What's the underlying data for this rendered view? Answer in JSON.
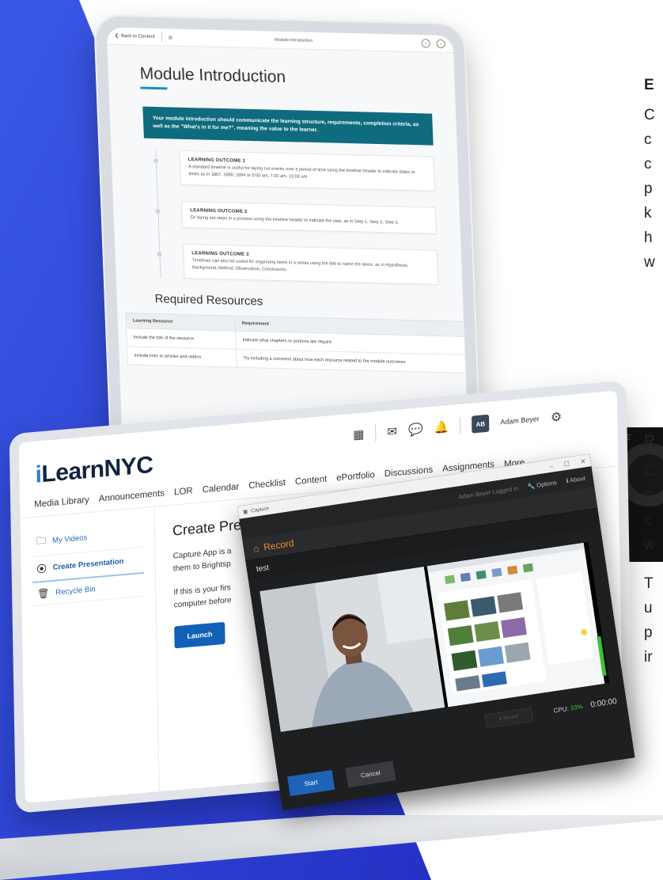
{
  "colors": {
    "blue": "#2d3fd6",
    "brand_blue": "#2a7de1",
    "brand_navy": "#10233f",
    "teal_banner": "#0f6b7e",
    "record_orange": "#f08a2a"
  },
  "tablet": {
    "back_label": "Back to Content",
    "breadcrumb": "Module Introduction",
    "title": "Module Introduction",
    "banner": "Your module introduction should communicate the learning structure, requirements, completion criteria, as well as the \"What's in it for me?\", meaning the value to the learner.",
    "outcomes": [
      {
        "title": "LEARNING OUTCOME 1",
        "text": "A standard timeline is useful for laying out events over a period of time using the timeline header to indicate dates or times as in 1867, 1880, 1894 or 5:00 am, 7:00 am, 10:00 am"
      },
      {
        "title": "LEARNING OUTCOME 2",
        "text": "Or laying out steps in a process using the timeline header to indicate the step, as in Step 1, Step 2, Step 3."
      },
      {
        "title": "LEARNING OUTCOME 3",
        "text": "Timelines can also be useful for organizing items in a series using the title to name the items, as in Hypothesis, Background, Method, Observation, Conclusions."
      }
    ],
    "resources_title": "Required Resources",
    "table_headers": [
      "Learning Resource",
      "Requirement"
    ],
    "table_rows": [
      [
        "Include the title of the resource",
        "Indicate what chapters or portions are require"
      ],
      [
        "Include links to articles and videos",
        "Try including a comment about how each resource related to the module outcomes"
      ]
    ]
  },
  "laptop": {
    "logo_i": "i",
    "logo_rest": "LearnNYC",
    "user_initials": "AB",
    "user_name": "Adam Beyer",
    "nav": [
      "Media Library",
      "Announcements",
      "LOR",
      "Calendar",
      "Checklist",
      "Content",
      "ePortfolio",
      "Discussions",
      "Assignments",
      "More"
    ],
    "sidebar": [
      {
        "label": "My Videos",
        "icon": "folder-icon"
      },
      {
        "label": "Create Presentation",
        "icon": "presentation-icon"
      },
      {
        "label": "Recycle Bin",
        "icon": "trash-icon"
      }
    ],
    "heading": "Create Presentation",
    "para1": "Capture App is a them to Brightsp",
    "para2": "If this is your firs computer before",
    "launch_label": "Launch"
  },
  "capture": {
    "window_title": "Capture",
    "user_status": "Adam Beyer   Logged in",
    "options_label": "Options",
    "about_label": "About",
    "record_label": "Record",
    "name_value": "test",
    "cpu_label": "CPU:",
    "cpu_value": "33%",
    "timer": "0:00:00",
    "start_label": "Start",
    "cancel_label": "Cancel"
  },
  "right_text": [
    {
      "letter": "E",
      "bold": true
    },
    {
      "letter": "C"
    },
    {
      "letter": "c"
    },
    {
      "letter": "c"
    },
    {
      "letter": "p"
    },
    {
      "letter": "k"
    },
    {
      "letter": "h"
    },
    {
      "letter": "w"
    },
    {
      "letter": "R",
      "bold": true
    },
    {
      "letter": "C"
    },
    {
      "letter": "n"
    },
    {
      "letter": "c"
    },
    {
      "letter": "w"
    },
    {
      "letter": "T"
    },
    {
      "letter": "u"
    },
    {
      "letter": "p"
    },
    {
      "letter": "ir"
    }
  ]
}
